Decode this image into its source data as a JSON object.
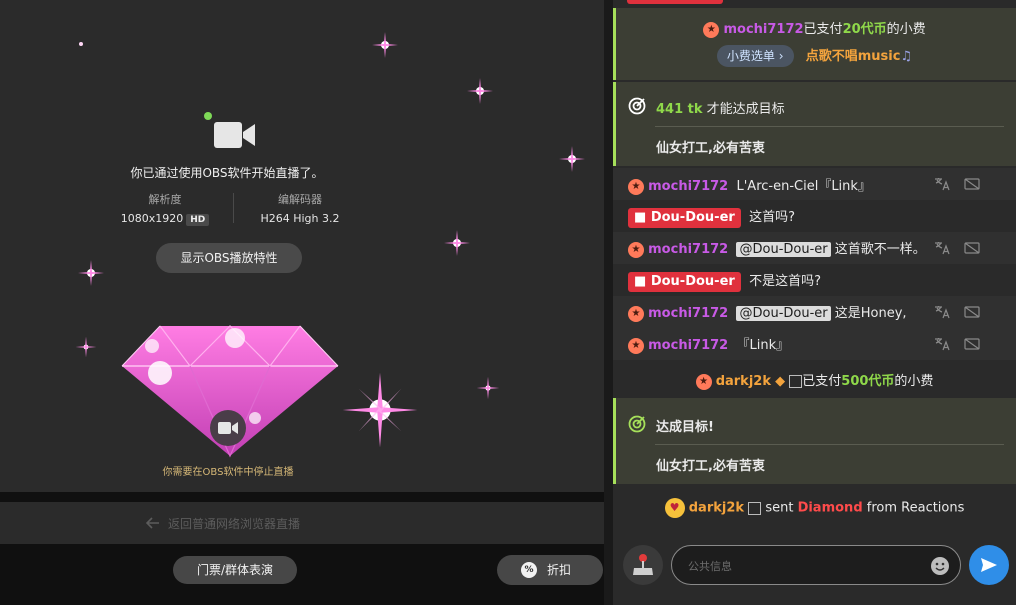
{
  "stage": {
    "obs_message": "你已通过使用OBS软件开始直播了。",
    "resolution_label": "解析度",
    "resolution_value": "1080x1920",
    "hd_badge": "HD",
    "codec_label": "编解码器",
    "codec_value": "H264 High 3.2",
    "obs_props_button": "显示OBS播放特性",
    "stop_hint": "你需要在OBS软件中停止直播"
  },
  "back_bar": {
    "label": "返回普通网络浏览器直播"
  },
  "bottom": {
    "ticket_button": "门票/群体表演",
    "discount_button": "折扣",
    "discount_icon": "%"
  },
  "chat": {
    "tip1": {
      "user": "mochi7172",
      "text_before": "已支付",
      "amount": "20代币",
      "text_after": "的小费",
      "menu_chip": "小费选单",
      "request": "点歌不唱music"
    },
    "goal": {
      "tokens": "441 tk",
      "text": "才能达成目标",
      "title": "仙女打工,必有苦衷"
    },
    "messages": [
      {
        "user": "mochi7172",
        "text": "L'Arc-en-Ciel『Link』"
      },
      {
        "user": "Dou-Dou-er",
        "text": "这首吗?"
      },
      {
        "user": "mochi7172",
        "mention": "@Dou-Dou-er",
        "text": "这首歌不一样。"
      },
      {
        "user": "Dou-Dou-er",
        "text": "不是这首吗?"
      },
      {
        "user": "mochi7172",
        "mention": "@Dou-Dou-er",
        "text": "这是Honey,"
      },
      {
        "user": "mochi7172",
        "text": "『Link』"
      }
    ],
    "tip2": {
      "user": "darkj2k",
      "text_before": "已支付",
      "amount": "500代币",
      "text_after": "的小费"
    },
    "goal_reached": {
      "label": "达成目标!",
      "title": "仙女打工,必有苦衷"
    },
    "reaction": {
      "user": "darkj2k",
      "sent": "sent",
      "item": "Diamond",
      "from": "from Reactions"
    },
    "input_placeholder": "公共信息"
  },
  "colors": {
    "accent_green": "#a6e05a",
    "send_blue": "#2f8ee8",
    "host_red": "#e0313d",
    "user_purple": "#c85ae6",
    "user_orange": "#f3a33d"
  },
  "icons": [
    "camera-icon",
    "translate-icon",
    "report-icon",
    "star-icon",
    "goal-icon",
    "shield-icon",
    "emoji-icon",
    "send-icon",
    "joystick-icon",
    "back-arrow-icon",
    "percent-icon"
  ]
}
